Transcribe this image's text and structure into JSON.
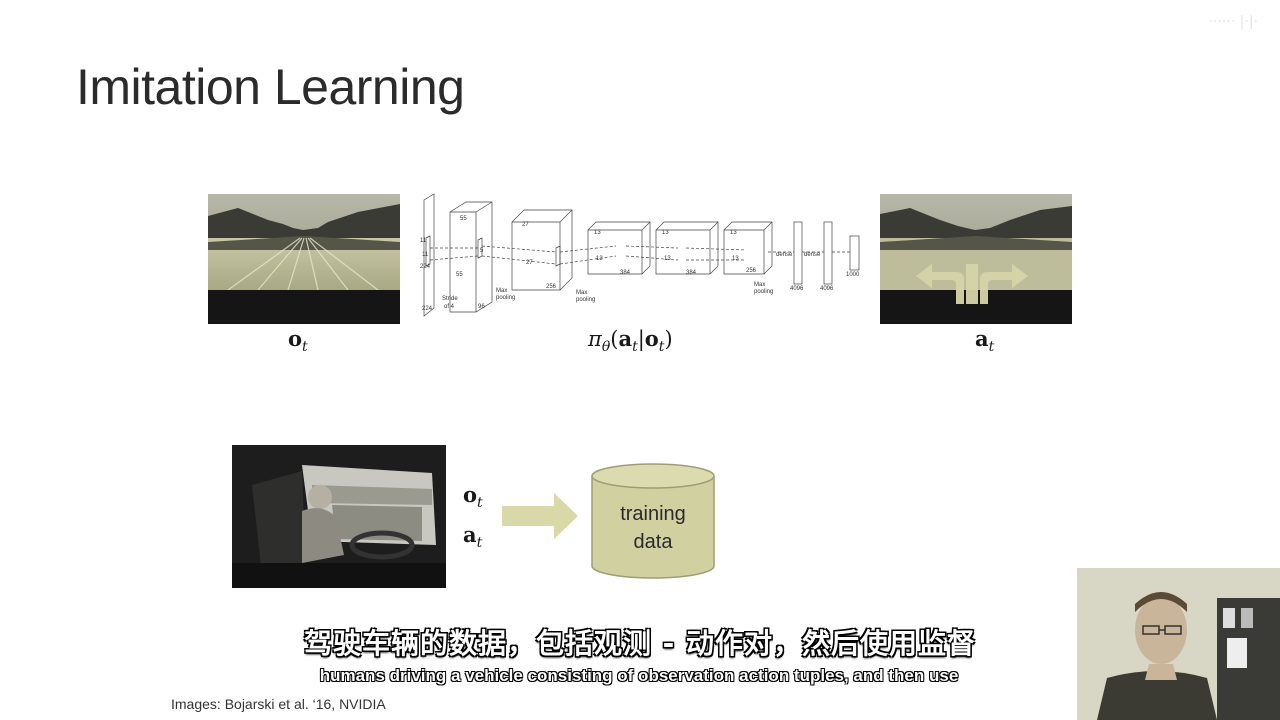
{
  "slide": {
    "title": "Imitation Learning",
    "watermark": "······ |·|·"
  },
  "top_row": {
    "observation_label": "o",
    "observation_sub": "t",
    "policy_pi": "π",
    "policy_theta": "θ",
    "policy_open": "(",
    "policy_a": "a",
    "policy_a_sub": "t",
    "policy_bar": "|",
    "policy_o": "o",
    "policy_o_sub": "t",
    "policy_close": ")",
    "action_label": "a",
    "action_sub": "t"
  },
  "cnn_labels": {
    "n224a": "224",
    "n224b": "224",
    "n11a": "11",
    "n11b": "11",
    "n55a": "55",
    "n55b": "55",
    "n96": "96",
    "stride": "Stride",
    "of4": "of 4",
    "n27a": "27",
    "n27b": "27",
    "n256": "256",
    "n5a": "5",
    "maxpool1": "Max",
    "maxpool1b": "pooling",
    "maxpool2": "Max",
    "maxpool2b": "pooling",
    "n13a": "13",
    "n13b": "13",
    "n384a": "384",
    "n13c": "13",
    "n13d": "13",
    "n384b": "384",
    "n13e": "13",
    "n13f": "13",
    "n256b": "256",
    "maxpool3": "Max",
    "maxpool3b": "pooling",
    "dense1": "dense",
    "dense2": "dense",
    "n4096a": "4096",
    "n4096b": "4096",
    "n1000": "1000"
  },
  "bottom_row": {
    "o_label": "o",
    "o_sub": "t",
    "a_label": "a",
    "a_sub": "t",
    "db_line1": "training",
    "db_line2": "data"
  },
  "subtitles": {
    "chinese": "驾驶车辆的数据，包括观测 - 动作对，然后使用监督",
    "english": "humans driving a vehicle consisting of observation action tuples, and then use"
  },
  "credit": "Images: Bojarski et al. ‘16, NVIDIA",
  "colors": {
    "arrow_fill": "#d9d8a8",
    "cylinder_fill": "#d1d0a0",
    "cylinder_stroke": "#9e9d74",
    "title_color": "#2b2b2b"
  }
}
